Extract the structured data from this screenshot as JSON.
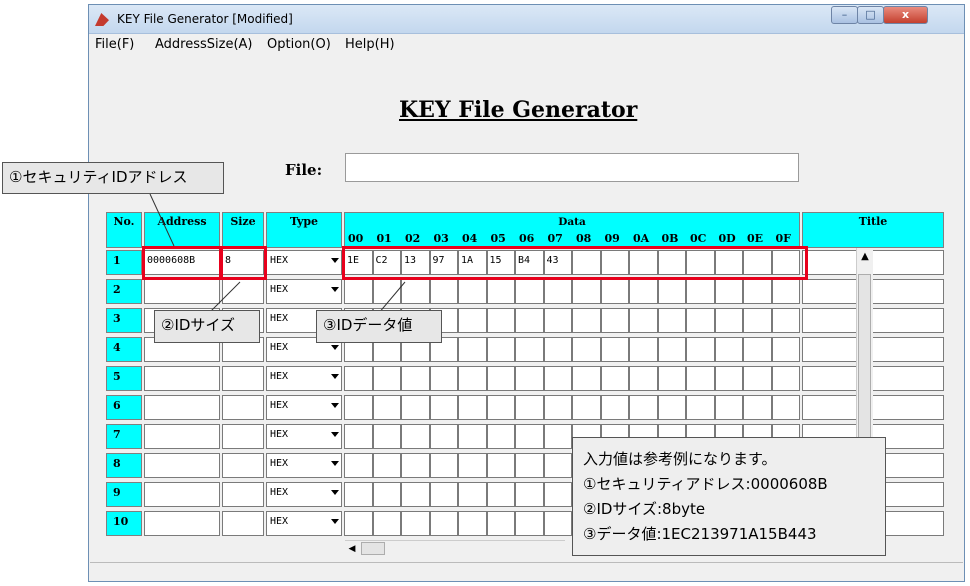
{
  "window": {
    "title": "KEY File Generator [Modified]",
    "controls": {
      "minimize": "–",
      "maximize": "□",
      "close": "x"
    }
  },
  "menu": [
    "File(F)",
    "AddressSize(A)",
    "Option(O)",
    "Help(H)"
  ],
  "heading": "KEY File Generator",
  "file": {
    "label": "File:",
    "value": ""
  },
  "table": {
    "headers": {
      "no": "No.",
      "address": "Address",
      "size": "Size",
      "type": "Type",
      "data": "Data",
      "title": "Title"
    },
    "data_columns": [
      "00",
      "01",
      "02",
      "03",
      "04",
      "05",
      "06",
      "07",
      "08",
      "09",
      "0A",
      "0B",
      "0C",
      "0D",
      "0E",
      "0F"
    ],
    "rows": [
      {
        "no": "1",
        "address": "0000608B",
        "size": "8",
        "type": "HEX",
        "data": [
          "1E",
          "C2",
          "13",
          "97",
          "1A",
          "15",
          "B4",
          "43",
          "",
          "",
          "",
          "",
          "",
          "",
          "",
          ""
        ],
        "title": ""
      },
      {
        "no": "2",
        "address": "",
        "size": "",
        "type": "HEX",
        "data": [],
        "title": ""
      },
      {
        "no": "3",
        "address": "",
        "size": "",
        "type": "HEX",
        "data": [],
        "title": ""
      },
      {
        "no": "4",
        "address": "",
        "size": "",
        "type": "HEX",
        "data": [],
        "title": ""
      },
      {
        "no": "5",
        "address": "",
        "size": "",
        "type": "HEX",
        "data": [],
        "title": ""
      },
      {
        "no": "6",
        "address": "",
        "size": "",
        "type": "HEX",
        "data": [],
        "title": ""
      },
      {
        "no": "7",
        "address": "",
        "size": "",
        "type": "HEX",
        "data": [],
        "title": ""
      },
      {
        "no": "8",
        "address": "",
        "size": "",
        "type": "HEX",
        "data": [],
        "title": ""
      },
      {
        "no": "9",
        "address": "",
        "size": "",
        "type": "HEX",
        "data": [],
        "title": ""
      },
      {
        "no": "10",
        "address": "",
        "size": "",
        "type": "HEX",
        "data": [],
        "title": ""
      }
    ]
  },
  "callouts": {
    "address": "①セキュリティIDアドレス",
    "size": "②IDサイズ",
    "data": "③IDデータ値"
  },
  "note": {
    "lines": [
      "入力値は参考例になります。",
      "①セキュリティアドレス:0000608B",
      "②IDサイズ:8byte",
      "③データ値:1EC213971A15B443"
    ]
  },
  "colors": {
    "header_bg": "#00ffff",
    "highlight": "#e8001c",
    "titlebar": "#c3d7ee"
  }
}
